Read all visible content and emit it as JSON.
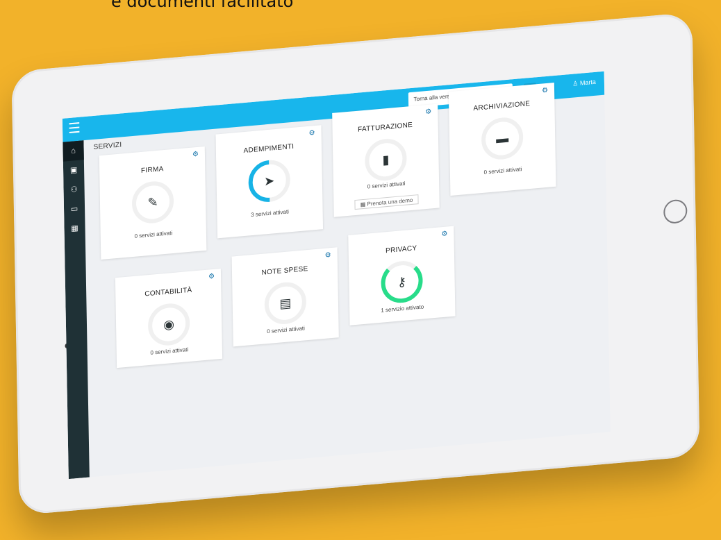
{
  "headline": "e documenti facilitato",
  "topbar": {
    "classic_button": "Torna alla versione classica di Agyo ®",
    "user_name": "Marta"
  },
  "sidebar": {
    "items": [
      {
        "name": "home",
        "icon": "home-icon",
        "active": true
      },
      {
        "name": "briefcase",
        "icon": "briefcase-icon"
      },
      {
        "name": "users",
        "icon": "users-icon"
      },
      {
        "name": "id-card",
        "icon": "id-card-icon"
      },
      {
        "name": "apps",
        "icon": "grid-icon"
      }
    ]
  },
  "section_title": "SERVIZI",
  "cards": [
    {
      "title": "FIRMA",
      "status": "0 servizi attivati",
      "icon": "pencil-icon",
      "ring": "empty"
    },
    {
      "title": "ADEMPIMENTI",
      "status": "3 servizi attivati",
      "icon": "paper-plane-icon",
      "ring": "blue"
    },
    {
      "title": "FATTURAZIONE",
      "status": "0 servizi attivati",
      "icon": "file-icon",
      "ring": "empty",
      "demo_button": "Prenota una demo"
    },
    {
      "title": "ARCHIVIAZIONE",
      "status": "0 servizi attivati",
      "icon": "archive-icon",
      "ring": "empty"
    },
    {
      "title": "CONTABILITÀ",
      "status": "0 servizi attivati",
      "icon": "globe-icon",
      "ring": "empty"
    },
    {
      "title": "NOTE SPESE",
      "status": "0 servizi attivati",
      "icon": "document-icon",
      "ring": "empty"
    },
    {
      "title": "PRIVACY",
      "status": "1 servizio attivato",
      "icon": "key-icon",
      "ring": "green"
    }
  ],
  "colors": {
    "background": "#f2b22a",
    "topbar": "#18b6ec",
    "sidebar": "#1f3136",
    "ring_blue": "#17b3e6",
    "ring_green": "#28dc8a"
  }
}
